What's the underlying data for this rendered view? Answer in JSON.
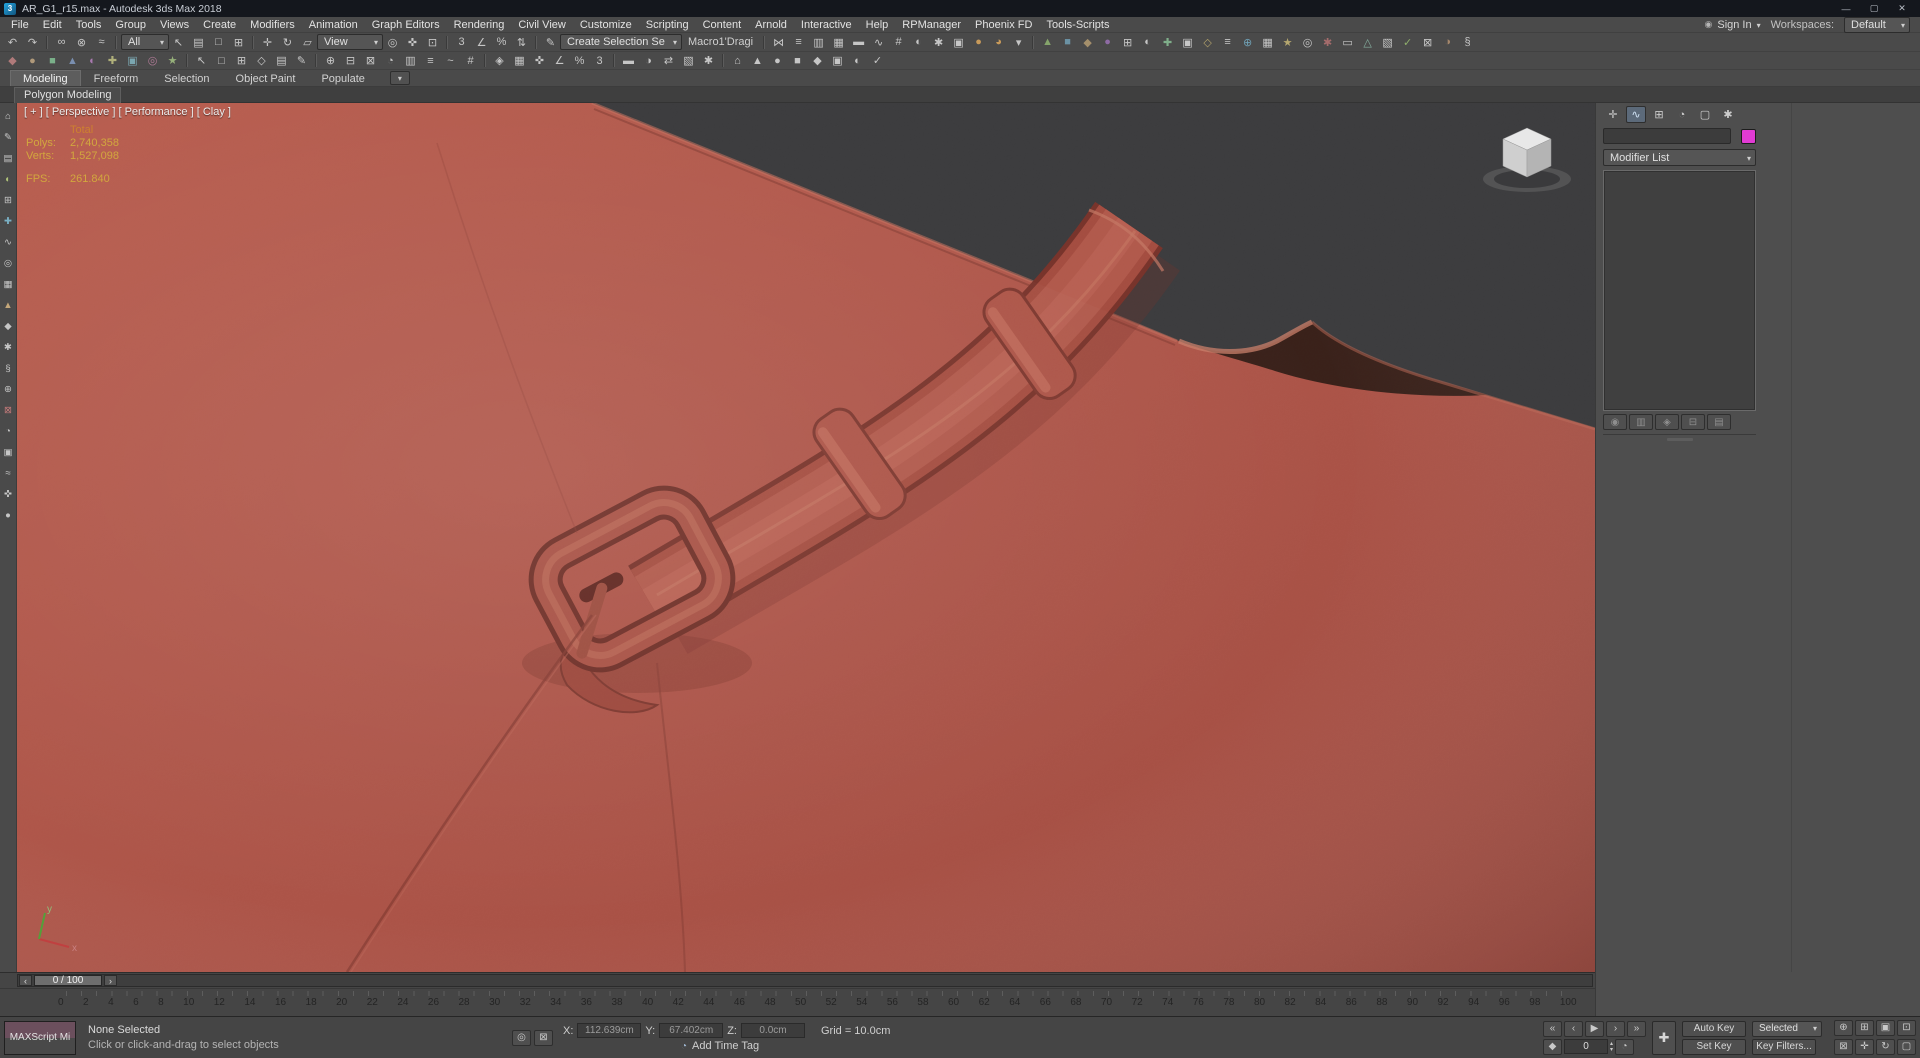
{
  "colors": {
    "clay": "#ac5246",
    "clay_dark": "#7c352c",
    "viewport_bg": "#3a3a3c",
    "object_color": "#e23bd4",
    "stats_text": "#d2a73e",
    "stats_total": "#cd8030",
    "active_viewport_border": "#8d7447"
  },
  "window": {
    "title": "AR_G1_r15.max - Autodesk 3ds Max 2018",
    "logo": "3",
    "minimize": "—",
    "maximize": "▢",
    "close": "✕"
  },
  "menu": {
    "items": [
      {
        "name": "menu-file",
        "label": "File"
      },
      {
        "name": "menu-edit",
        "label": "Edit"
      },
      {
        "name": "menu-tools",
        "label": "Tools"
      },
      {
        "name": "menu-group",
        "label": "Group"
      },
      {
        "name": "menu-views",
        "label": "Views"
      },
      {
        "name": "menu-create",
        "label": "Create"
      },
      {
        "name": "menu-modifiers",
        "label": "Modifiers"
      },
      {
        "name": "menu-animation",
        "label": "Animation"
      },
      {
        "name": "menu-graph-editors",
        "label": "Graph Editors"
      },
      {
        "name": "menu-rendering",
        "label": "Rendering"
      },
      {
        "name": "menu-civil-view",
        "label": "Civil View"
      },
      {
        "name": "menu-customize",
        "label": "Customize"
      },
      {
        "name": "menu-scripting",
        "label": "Scripting"
      },
      {
        "name": "menu-content",
        "label": "Content"
      },
      {
        "name": "menu-arnold",
        "label": "Arnold"
      },
      {
        "name": "menu-interactive",
        "label": "Interactive"
      },
      {
        "name": "menu-help",
        "label": "Help"
      },
      {
        "name": "menu-rpmanager",
        "label": "RPManager"
      },
      {
        "name": "menu-phoenix-fd",
        "label": "Phoenix FD"
      },
      {
        "name": "menu-tools-scripts",
        "label": "Tools-Scripts"
      }
    ],
    "sign_in": "Sign In",
    "workspaces_label": "Workspaces:",
    "workspace_value": "Default"
  },
  "toolbar1": {
    "seg1": [
      {
        "name": "undo-icon",
        "glyph": "↶"
      },
      {
        "name": "redo-icon",
        "glyph": "↷"
      }
    ],
    "seg2": [
      {
        "name": "select-and-link-icon",
        "glyph": "∞"
      },
      {
        "name": "unlink-selection-icon",
        "glyph": "⊗"
      },
      {
        "name": "bind-to-space-warp-icon",
        "glyph": "≈"
      }
    ],
    "filter_value": "All",
    "seg3": [
      {
        "name": "select-object-icon",
        "glyph": "↖"
      },
      {
        "name": "select-by-name-icon",
        "glyph": "▤"
      },
      {
        "name": "selection-region-icon",
        "glyph": "□"
      },
      {
        "name": "window-crossing-icon",
        "glyph": "⊞"
      }
    ],
    "seg4": [
      {
        "name": "select-and-move-icon",
        "glyph": "✛"
      },
      {
        "name": "select-and-rotate-icon",
        "glyph": "↻"
      },
      {
        "name": "select-and-scale-icon",
        "glyph": "▱"
      }
    ],
    "coord_value": "View",
    "seg5": [
      {
        "name": "use-center-icon",
        "glyph": "◎"
      },
      {
        "name": "select-and-manipulate-icon",
        "glyph": "✜"
      },
      {
        "name": "keyboard-override-icon",
        "glyph": "⊡"
      }
    ],
    "seg6": [
      {
        "name": "snaps-toggle-icon",
        "glyph": "3"
      },
      {
        "name": "angle-snap-icon",
        "glyph": "∠"
      },
      {
        "name": "percent-snap-icon",
        "glyph": "%"
      },
      {
        "name": "spinner-snap-icon",
        "glyph": "⇅"
      }
    ],
    "seg7": [
      {
        "name": "edit-named-selection-sets-icon",
        "glyph": "✎"
      }
    ],
    "selset_value": "Create Selection Se",
    "macro_text": "Macro1'Dragi",
    "seg8": [
      {
        "name": "mirror-icon",
        "glyph": "⋈"
      },
      {
        "name": "align-icon",
        "glyph": "≡"
      },
      {
        "name": "layer-explorer-icon",
        "glyph": "▥"
      },
      {
        "name": "scene-explorer-icon",
        "glyph": "▦"
      },
      {
        "name": "ribbon-toggle-icon",
        "glyph": "▬"
      },
      {
        "name": "curve-editor-icon",
        "glyph": "∿"
      },
      {
        "name": "schematic-view-icon",
        "glyph": "#"
      },
      {
        "name": "material-editor-icon",
        "glyph": "◐"
      },
      {
        "name": "render-setup-icon",
        "glyph": "✱"
      },
      {
        "name": "rendered-frame-window-icon",
        "glyph": "▣"
      },
      {
        "name": "render-production-icon",
        "glyph": "●",
        "color": "#c89a5a"
      },
      {
        "name": "render-iterative-icon",
        "glyph": "◕",
        "color": "#c89a5a"
      },
      {
        "name": "render-flyout-icon",
        "glyph": "▾"
      }
    ],
    "seg9": [
      {
        "name": "plugin-icon-1",
        "glyph": "▲",
        "color": "#85a46b"
      },
      {
        "name": "plugin-icon-2",
        "glyph": "■",
        "color": "#6b92a4"
      },
      {
        "name": "plugin-icon-3",
        "glyph": "◆",
        "color": "#a48f6b"
      },
      {
        "name": "plugin-icon-4",
        "glyph": "●",
        "color": "#8e6ba4"
      },
      {
        "name": "plugin-icon-5",
        "glyph": "⊞"
      },
      {
        "name": "plugin-icon-6",
        "glyph": "◐"
      },
      {
        "name": "plugin-icon-7",
        "glyph": "✚",
        "color": "#7fae8a"
      },
      {
        "name": "plugin-icon-8",
        "glyph": "▣"
      },
      {
        "name": "plugin-icon-9",
        "glyph": "◇",
        "color": "#b0a06a"
      },
      {
        "name": "plugin-icon-10",
        "glyph": "≡"
      },
      {
        "name": "plugin-icon-11",
        "glyph": "⊕",
        "color": "#6fa0b5"
      },
      {
        "name": "plugin-icon-12",
        "glyph": "▦"
      },
      {
        "name": "plugin-icon-13",
        "glyph": "★",
        "color": "#b5a76f"
      },
      {
        "name": "plugin-icon-14",
        "glyph": "◎"
      },
      {
        "name": "plugin-icon-15",
        "glyph": "✱",
        "color": "#a56c6c"
      },
      {
        "name": "plugin-icon-16",
        "glyph": "▭"
      },
      {
        "name": "plugin-icon-17",
        "glyph": "△",
        "color": "#86b0a0"
      },
      {
        "name": "plugin-icon-18",
        "glyph": "▧"
      },
      {
        "name": "plugin-icon-19",
        "glyph": "✓",
        "color": "#8fae6b"
      },
      {
        "name": "plugin-icon-20",
        "glyph": "⊠"
      },
      {
        "name": "plugin-icon-21",
        "glyph": "◑",
        "color": "#a4866b"
      },
      {
        "name": "plugin-icon-22",
        "glyph": "§"
      }
    ]
  },
  "toolbar2": {
    "g1": [
      {
        "name": "toolbar2-icon-1",
        "glyph": "◆",
        "color": "#b07a7a"
      },
      {
        "name": "toolbar2-icon-2",
        "glyph": "●",
        "color": "#b0997a"
      },
      {
        "name": "toolbar2-icon-3",
        "glyph": "■",
        "color": "#7ab089"
      },
      {
        "name": "toolbar2-icon-4",
        "glyph": "▲",
        "color": "#7a8fb0"
      },
      {
        "name": "toolbar2-icon-5",
        "glyph": "◐",
        "color": "#a97ab0"
      },
      {
        "name": "toolbar2-icon-6",
        "glyph": "✚",
        "color": "#b0b07a"
      },
      {
        "name": "toolbar2-icon-7",
        "glyph": "▣",
        "color": "#7aa6b0"
      },
      {
        "name": "toolbar2-icon-8",
        "glyph": "◎",
        "color": "#b07a96"
      },
      {
        "name": "toolbar2-icon-9",
        "glyph": "★",
        "color": "#96b07a"
      }
    ],
    "g2": [
      {
        "name": "toolbar2-icon-10",
        "glyph": "↖"
      },
      {
        "name": "toolbar2-icon-11",
        "glyph": "□"
      },
      {
        "name": "toolbar2-icon-12",
        "glyph": "⊞"
      },
      {
        "name": "toolbar2-icon-13",
        "glyph": "◇"
      },
      {
        "name": "toolbar2-icon-14",
        "glyph": "▤"
      },
      {
        "name": "toolbar2-icon-15",
        "glyph": "✎"
      }
    ],
    "g3": [
      {
        "name": "toolbar2-icon-16",
        "glyph": "⊕"
      },
      {
        "name": "toolbar2-icon-17",
        "glyph": "⊟"
      },
      {
        "name": "toolbar2-icon-18",
        "glyph": "⊠"
      },
      {
        "name": "toolbar2-icon-19",
        "glyph": "◔"
      },
      {
        "name": "toolbar2-icon-20",
        "glyph": "▥"
      },
      {
        "name": "toolbar2-icon-21",
        "glyph": "≡"
      },
      {
        "name": "toolbar2-icon-22",
        "glyph": "~"
      },
      {
        "name": "toolbar2-icon-23",
        "glyph": "#"
      }
    ],
    "g4": [
      {
        "name": "toolbar2-icon-24",
        "glyph": "◈"
      },
      {
        "name": "toolbar2-icon-25",
        "glyph": "▦"
      },
      {
        "name": "toolbar2-icon-26",
        "glyph": "✜"
      },
      {
        "name": "toolbar2-icon-27",
        "glyph": "∠"
      },
      {
        "name": "toolbar2-icon-28",
        "glyph": "%"
      },
      {
        "name": "toolbar2-icon-29",
        "glyph": "3"
      }
    ],
    "g5": [
      {
        "name": "toolbar2-icon-30",
        "glyph": "▬"
      },
      {
        "name": "toolbar2-icon-31",
        "glyph": "◑"
      },
      {
        "name": "toolbar2-icon-32",
        "glyph": "⇄"
      },
      {
        "name": "toolbar2-icon-33",
        "glyph": "▧"
      },
      {
        "name": "toolbar2-icon-34",
        "glyph": "✱"
      }
    ],
    "g6": [
      {
        "name": "toolbar2-icon-35",
        "glyph": "⌂"
      },
      {
        "name": "toolbar2-icon-36",
        "glyph": "▲"
      },
      {
        "name": "toolbar2-icon-37",
        "glyph": "●"
      },
      {
        "name": "toolbar2-icon-38",
        "glyph": "■"
      },
      {
        "name": "toolbar2-icon-39",
        "glyph": "◆"
      },
      {
        "name": "toolbar2-icon-40",
        "glyph": "▣"
      },
      {
        "name": "toolbar2-icon-41",
        "glyph": "◐"
      },
      {
        "name": "toolbar2-icon-42",
        "glyph": "✓"
      }
    ]
  },
  "ribbon": {
    "tabs": [
      {
        "name": "ribbon-tab-modeling",
        "label": "Modeling",
        "active": true
      },
      {
        "name": "ribbon-tab-freeform",
        "label": "Freeform"
      },
      {
        "name": "ribbon-tab-selection",
        "label": "Selection"
      },
      {
        "name": "ribbon-tab-object-paint",
        "label": "Object Paint"
      },
      {
        "name": "ribbon-tab-populate",
        "label": "Populate"
      }
    ],
    "subtab": "Polygon Modeling"
  },
  "left_dock": [
    {
      "name": "left-dock-icon-1",
      "glyph": "⌂"
    },
    {
      "name": "left-dock-icon-2",
      "glyph": "✎"
    },
    {
      "name": "left-dock-icon-3",
      "glyph": "▤"
    },
    {
      "name": "left-dock-icon-4",
      "glyph": "◐",
      "color": "#b0c47a"
    },
    {
      "name": "left-dock-icon-5",
      "glyph": "⊞"
    },
    {
      "name": "left-dock-icon-6",
      "glyph": "✚",
      "color": "#7ab0c4"
    },
    {
      "name": "left-dock-icon-7",
      "glyph": "∿"
    },
    {
      "name": "left-dock-icon-8",
      "glyph": "◎"
    },
    {
      "name": "left-dock-icon-9",
      "glyph": "▦"
    },
    {
      "name": "left-dock-icon-10",
      "glyph": "▲",
      "color": "#c4a77a"
    },
    {
      "name": "left-dock-icon-11",
      "glyph": "◆"
    },
    {
      "name": "left-dock-icon-12",
      "glyph": "✱"
    },
    {
      "name": "left-dock-icon-13",
      "glyph": "§"
    },
    {
      "name": "left-dock-icon-14",
      "glyph": "⊕"
    },
    {
      "name": "left-dock-icon-15",
      "glyph": "⊠",
      "color": "#c47a7a"
    },
    {
      "name": "left-dock-icon-16",
      "glyph": "◔"
    },
    {
      "name": "left-dock-icon-17",
      "glyph": "▣"
    },
    {
      "name": "left-dock-icon-18",
      "glyph": "≈"
    },
    {
      "name": "left-dock-icon-19",
      "glyph": "✜"
    },
    {
      "name": "left-dock-icon-20",
      "glyph": "●"
    }
  ],
  "viewport": {
    "label": "[ + ] [ Perspective ] [ Performance ] [ Clay ]",
    "stats": {
      "total_label": "Total",
      "polys_label": "Polys:",
      "polys": "2,740,358",
      "verts_label": "Verts:",
      "verts": "1,527,098",
      "fps_label": "FPS:",
      "fps": "261.840"
    },
    "axis_x": "x",
    "axis_y": "y"
  },
  "panel": {
    "tabs": [
      {
        "name": "create-tab",
        "glyph": "✛"
      },
      {
        "name": "modify-tab",
        "glyph": "∿",
        "active": true
      },
      {
        "name": "hierarchy-tab",
        "glyph": "⊞"
      },
      {
        "name": "motion-tab",
        "glyph": "◔"
      },
      {
        "name": "display-tab",
        "glyph": "▢"
      },
      {
        "name": "utilities-tab",
        "glyph": "✱"
      }
    ],
    "modifier_list_label": "Modifier List",
    "stack_buttons": [
      {
        "name": "pin-stack-button",
        "glyph": "◉"
      },
      {
        "name": "show-end-result-button",
        "glyph": "▥"
      },
      {
        "name": "make-unique-button",
        "glyph": "◈"
      },
      {
        "name": "remove-modifier-button",
        "glyph": "⊟"
      },
      {
        "name": "configure-modifier-sets-button",
        "glyph": "▤"
      }
    ]
  },
  "timeline": {
    "slider_value": "0 / 100",
    "prev": "‹",
    "next": "›",
    "ticks": [
      0,
      2,
      4,
      6,
      8,
      10,
      12,
      14,
      16,
      18,
      20,
      22,
      24,
      26,
      28,
      30,
      32,
      34,
      36,
      38,
      40,
      42,
      44,
      46,
      48,
      50,
      52,
      54,
      56,
      58,
      60,
      62,
      64,
      66,
      68,
      70,
      72,
      74,
      76,
      78,
      80,
      82,
      84,
      86,
      88,
      90,
      92,
      94,
      96,
      98,
      100
    ]
  },
  "status": {
    "maxscript_label": "MAXScript Mi",
    "status": "None Selected",
    "prompt": "Click or click-and-drag to select objects",
    "x_label": "X:",
    "x_value": "112.639cm",
    "y_label": "Y:",
    "y_value": "67.402cm",
    "z_label": "Z:",
    "z_value": "0.0cm",
    "grid": "Grid = 10.0cm",
    "time_tag": "Add Time Tag",
    "time_tag_glyph": "◔",
    "auto_key": "Auto Key",
    "set_key": "Set Key",
    "selected": "Selected",
    "key_filters": "Key Filters...",
    "frame": "0",
    "key_mode_glyph": "◆",
    "set_keys_glyph": "✚",
    "toggles": [
      {
        "name": "isolate-selection-toggle",
        "glyph": "◎"
      },
      {
        "name": "selection-lock-toggle",
        "glyph": "⊠"
      }
    ]
  },
  "transport": {
    "row1": [
      {
        "name": "go-to-start-button",
        "glyph": "«"
      },
      {
        "name": "previous-frame-button",
        "glyph": "‹"
      },
      {
        "name": "play-button",
        "glyph": "▶"
      },
      {
        "name": "next-frame-button",
        "glyph": "›"
      },
      {
        "name": "go-to-end-button",
        "glyph": "»"
      }
    ]
  },
  "nav": [
    {
      "name": "zoom-button",
      "glyph": "⊕"
    },
    {
      "name": "zoom-all-button",
      "glyph": "⊞"
    },
    {
      "name": "zoom-extents-button",
      "glyph": "▣"
    },
    {
      "name": "zoom-extents-all-button",
      "glyph": "⊡"
    },
    {
      "name": "zoom-region-button",
      "glyph": "⊠"
    },
    {
      "name": "pan-button",
      "glyph": "✛"
    },
    {
      "name": "orbit-button",
      "glyph": "↻"
    },
    {
      "name": "maximize-viewport-button",
      "glyph": "▢"
    }
  ]
}
